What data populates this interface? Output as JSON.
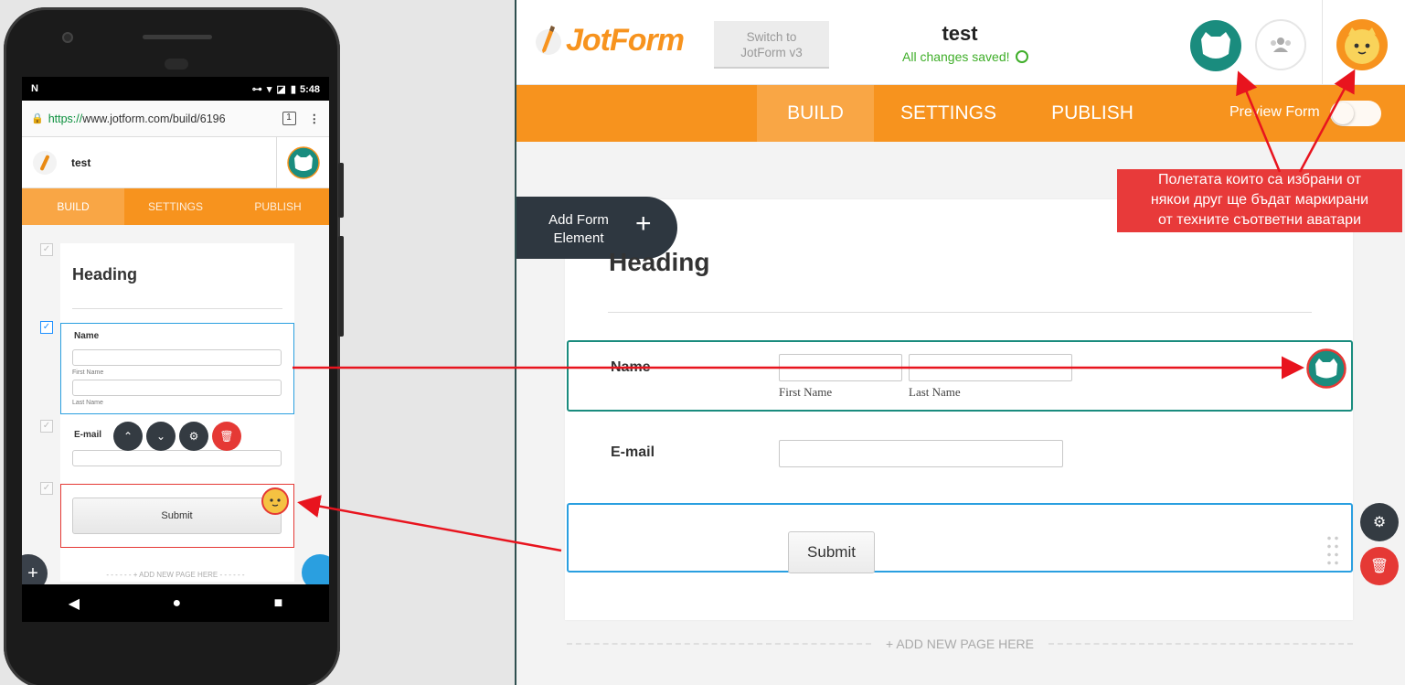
{
  "phone": {
    "status": {
      "carrier": "N",
      "icons": "⊶ ▾ ◪ ▮",
      "time": "5:48"
    },
    "browser": {
      "url_proto": "https://",
      "url_rest": "www.jotform.com/build/6196",
      "tab_count": "1",
      "menu": "⋮"
    },
    "header": {
      "title": "test"
    },
    "tabs": [
      "BUILD",
      "SETTINGS",
      "PUBLISH"
    ],
    "form": {
      "heading": "Heading",
      "name_label": "Name",
      "first_name": "First Name",
      "last_name": "Last Name",
      "email_label": "E-mail",
      "submit": "Submit",
      "add_page": "- - - - - -   + ADD NEW PAGE HERE   - - - - - -"
    },
    "nav": {
      "back": "◀",
      "home": "●",
      "recent": "■"
    }
  },
  "builder": {
    "logo_text": "JotForm",
    "switch_btn": [
      "Switch to",
      "JotForm v3"
    ],
    "form_title": "test",
    "saved_status": "All changes saved!",
    "tabs": [
      "BUILD",
      "SETTINGS",
      "PUBLISH"
    ],
    "preview_label": "Preview Form",
    "add_element": [
      "Add Form",
      "Element"
    ],
    "add_element_plus": "+",
    "form": {
      "heading": "Heading",
      "name_label": "Name",
      "first_name": "First Name",
      "last_name": "Last Name",
      "email_label": "E-mail",
      "submit": "Submit"
    },
    "add_page": "+ ADD NEW PAGE HERE"
  },
  "annotation": {
    "lines": [
      "Полетата които са избрани от",
      "някои друг ще бъдат маркирани",
      "от техните съответни аватари"
    ]
  },
  "colors": {
    "orange": "#f7931e",
    "teal": "#1a8c7e",
    "blue": "#2a9fe0",
    "red": "#e53935",
    "dark": "#2e3740"
  },
  "icons": {
    "teal_avatar": "cat-avatar-icon-teal",
    "yellow_avatar": "cat-avatar-icon-yellow",
    "collab": "users-icon",
    "settings": "gear-icon",
    "delete": "trash-icon"
  }
}
